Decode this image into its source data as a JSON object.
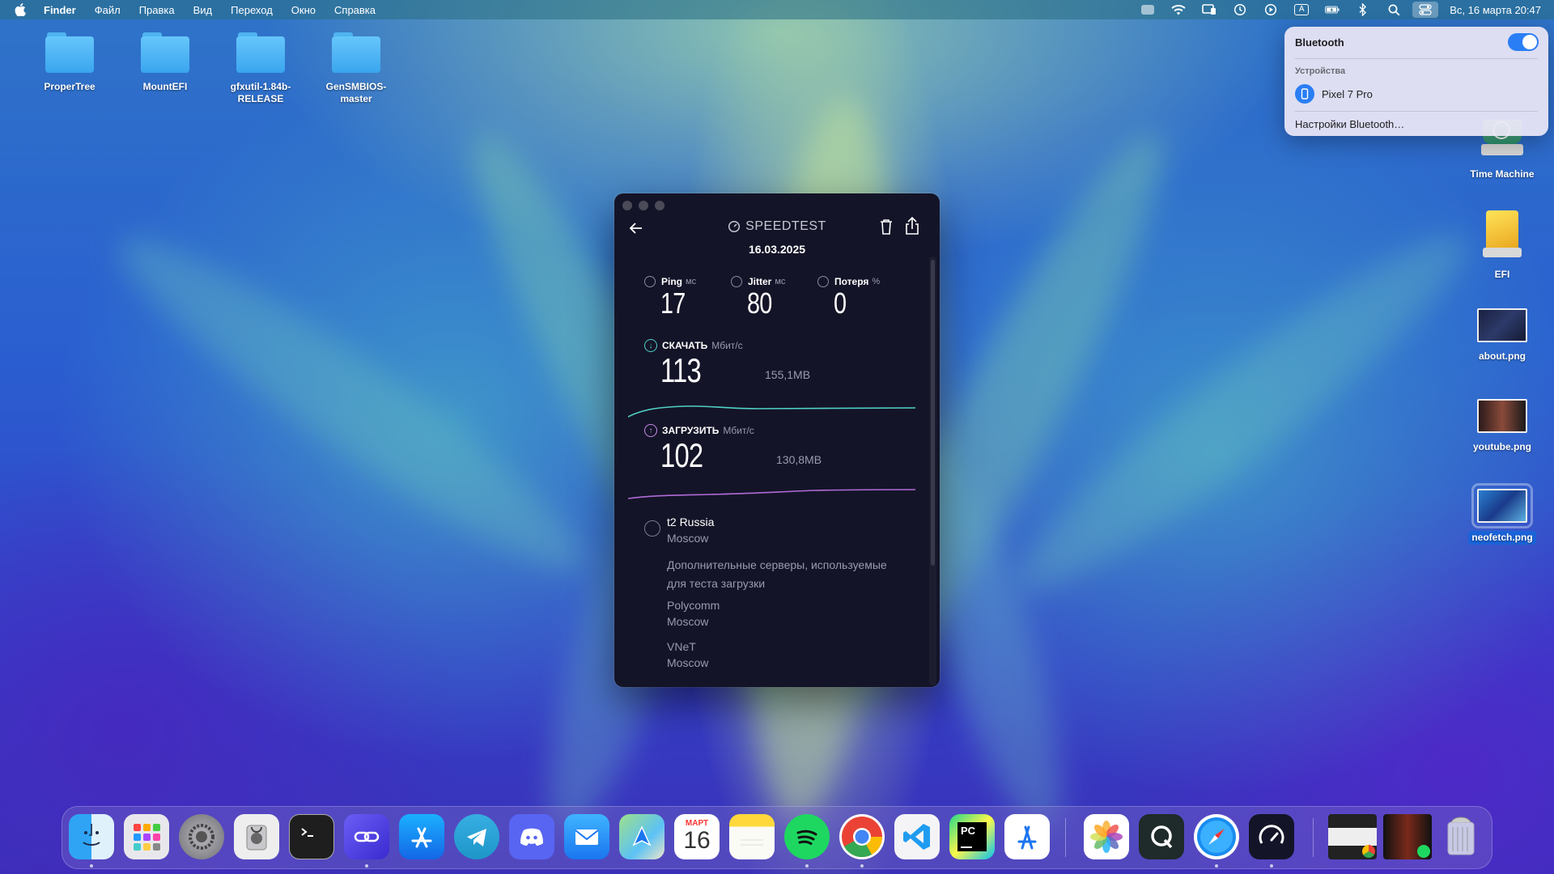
{
  "menubar": {
    "app": "Finder",
    "items": [
      "Файл",
      "Правка",
      "Вид",
      "Переход",
      "Окно",
      "Справка"
    ],
    "input_source": "A",
    "clock": "Вс, 16 марта  20:47"
  },
  "desktop": {
    "folders": [
      {
        "label": "ProperTree"
      },
      {
        "label": "MountEFI"
      },
      {
        "label": "gfxutil-1.84b-RELEASE"
      },
      {
        "label": "GenSMBIOS-master"
      }
    ],
    "right_items": [
      {
        "label": "Time Machine"
      },
      {
        "label": "EFI"
      },
      {
        "label": "about.png"
      },
      {
        "label": "youtube.png"
      },
      {
        "label": "neofetch.png"
      }
    ]
  },
  "bluetooth": {
    "title": "Bluetooth",
    "enabled": true,
    "section": "Устройства",
    "device": "Pixel 7 Pro",
    "settings": "Настройки Bluetooth…"
  },
  "speedtest": {
    "title": "SPEEDTEST",
    "date": "16.03.2025",
    "ping": {
      "label": "Ping",
      "unit": "мс",
      "value": "17"
    },
    "jitter": {
      "label": "Jitter",
      "unit": "мс",
      "value": "80"
    },
    "loss": {
      "label": "Потеря",
      "unit": "%",
      "value": "0"
    },
    "download": {
      "label": "СКАЧАТЬ",
      "unit": "Мбит/с",
      "value": "113",
      "size": "155,1MB"
    },
    "upload": {
      "label": "ЗАГРУЗИТЬ",
      "unit": "Мбит/с",
      "value": "102",
      "size": "130,8MB"
    },
    "server": {
      "name": "t2 Russia",
      "city": "Moscow"
    },
    "note": "Дополнительные серверы, используемые для теста загрузки",
    "note_line1": "Дополнительные серверы, используемые",
    "note_line2": "для теста загрузки",
    "alt_servers": [
      {
        "name": "Polycomm",
        "city": "Moscow"
      },
      {
        "name": "VNeT",
        "city": "Moscow"
      }
    ]
  },
  "dock": {
    "calendar_month": "МАРТ",
    "calendar_day": "16",
    "apps": [
      "finder-icon",
      "launchpad-icon",
      "system-settings-icon",
      "disk-utility-icon",
      "terminal-icon",
      "link-icon",
      "app-store-icon",
      "telegram-icon",
      "discord-icon",
      "mail-icon",
      "maps-icon",
      "calendar-icon",
      "notes-icon",
      "spotify-icon",
      "chrome-icon",
      "vscode-icon",
      "pycharm-icon",
      "xcode-instruments-icon",
      "photos-icon",
      "q-icon",
      "safari-icon",
      "speedtest-icon",
      "trash-icon"
    ]
  },
  "colors": {
    "download_accent": "#4fd1c5",
    "upload_accent": "#b06bd8",
    "toggle_on": "#2a7ef5",
    "window_bg": "#141428"
  }
}
